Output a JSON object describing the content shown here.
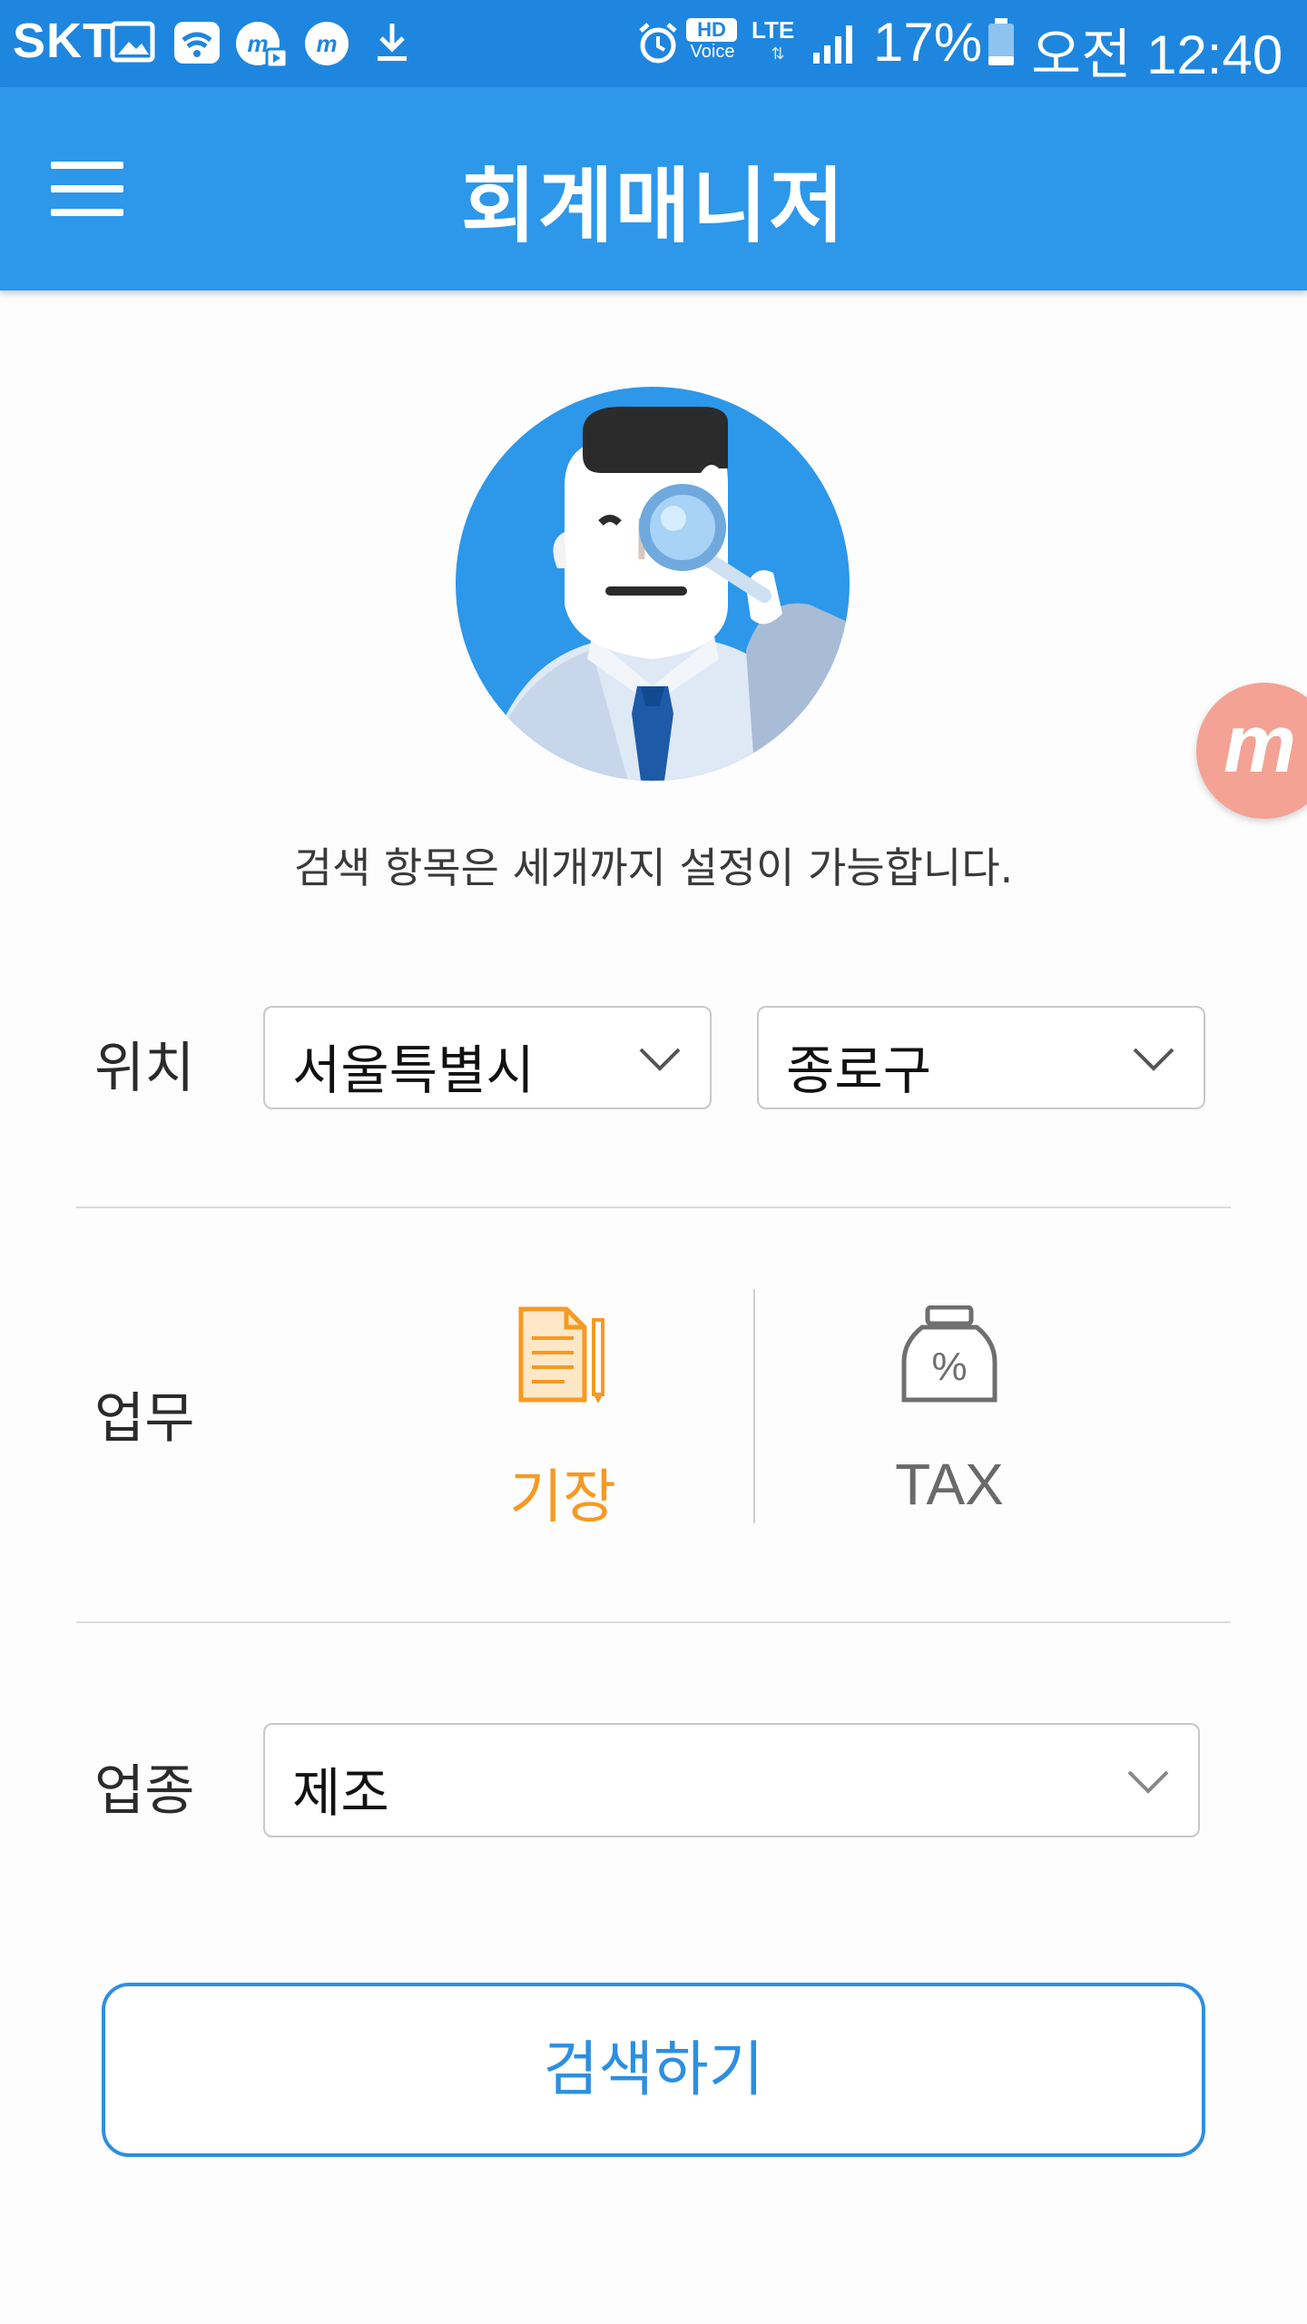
{
  "status_bar": {
    "carrier": "SKT",
    "icons": [
      "gallery-icon",
      "wifi-icon",
      "m-play-icon",
      "m-icon",
      "download-icon",
      "alarm-icon",
      "hd-voice-icon",
      "lte-icon",
      "signal-icon",
      "battery-icon"
    ],
    "hd_label": "HD",
    "voice_label": "Voice",
    "lte_label": "LTE",
    "battery_percent": "17%",
    "time": "오전 12:40"
  },
  "app_bar": {
    "title": "회계매니저",
    "menu_icon": "hamburger-menu-icon"
  },
  "colors": {
    "status_bar": "#1e86df",
    "app_bar": "#2d97ea",
    "accent_blue": "#2d8fe0",
    "selected_orange": "#f59a23",
    "badge_pink": "#f4a294"
  },
  "hint": "검색 항목은 세개까지 설정이 가능합니다.",
  "location": {
    "label": "위치",
    "city": "서울특별시",
    "district": "종로구"
  },
  "task": {
    "label": "업무",
    "options": [
      {
        "label": "기장",
        "icon": "document-pencil-icon",
        "selected": true
      },
      {
        "label": "TAX",
        "icon": "percent-bag-icon",
        "selected": false
      }
    ]
  },
  "industry": {
    "label": "업종",
    "value": "제조"
  },
  "search_button": "검색하기"
}
